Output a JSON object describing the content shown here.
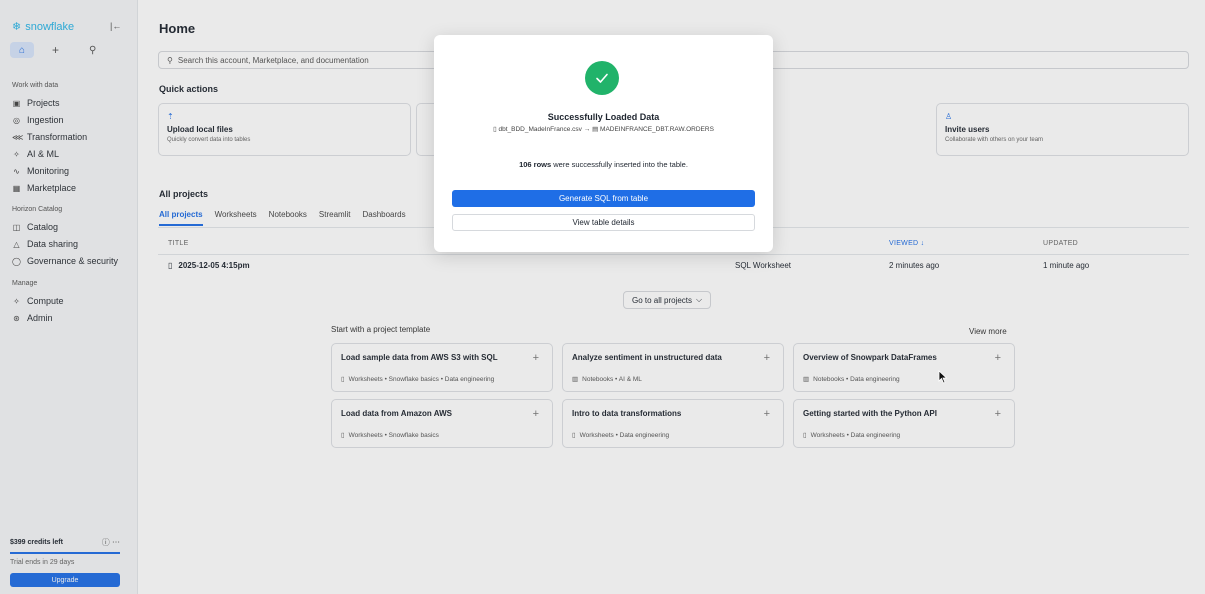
{
  "sidebar": {
    "logo": "snowflake",
    "sections": {
      "work": "Work with data",
      "horizon": "Horizon Catalog",
      "manage": "Manage"
    },
    "items": [
      {
        "label": "Projects",
        "icon": "projects-icon"
      },
      {
        "label": "Ingestion",
        "icon": "ingestion-icon"
      },
      {
        "label": "Transformation",
        "icon": "transformation-icon"
      },
      {
        "label": "AI & ML",
        "icon": "ai-ml-icon"
      },
      {
        "label": "Monitoring",
        "icon": "monitoring-icon"
      },
      {
        "label": "Marketplace",
        "icon": "marketplace-icon"
      },
      {
        "label": "Catalog",
        "icon": "catalog-icon"
      },
      {
        "label": "Data sharing",
        "icon": "data-sharing-icon"
      },
      {
        "label": "Governance & security",
        "icon": "shield-icon"
      },
      {
        "label": "Compute",
        "icon": "compute-icon"
      },
      {
        "label": "Admin",
        "icon": "admin-icon"
      }
    ],
    "credits": "$399 credits left",
    "credits_fraction": 1.0,
    "trial": "Trial ends in 29 days",
    "upgrade": "Upgrade"
  },
  "main": {
    "title": "Home",
    "search_placeholder": "Search this account, Marketplace, and documentation",
    "quick_actions_title": "Quick actions",
    "quick_actions": [
      {
        "title": "Upload local files",
        "desc": "Quickly convert data into tables"
      },
      {
        "title": "Invite users",
        "desc": "Collaborate with others on your team"
      }
    ],
    "all_projects_title": "All projects",
    "tabs": [
      "All projects",
      "Worksheets",
      "Notebooks",
      "Streamlit",
      "Dashboards"
    ],
    "columns": {
      "title": "TITLE",
      "viewed": "VIEWED ↓",
      "updated": "UPDATED"
    },
    "rows": [
      {
        "title": "2025-12-05 4:15pm",
        "type": "SQL Worksheet",
        "viewed": "2 minutes ago",
        "updated": "1 minute ago"
      }
    ],
    "go_all": "Go to all projects",
    "template_heading": "Start with a project template",
    "view_more": "View more",
    "templates": [
      {
        "title": "Load sample data from AWS S3 with SQL",
        "meta": "Worksheets • Snowflake basics • Data engineering"
      },
      {
        "title": "Analyze sentiment in unstructured data",
        "meta": "Notebooks • AI & ML"
      },
      {
        "title": "Overview of Snowpark DataFrames",
        "meta": "Notebooks • Data engineering"
      },
      {
        "title": "Load data from Amazon AWS",
        "meta": "Worksheets • Snowflake basics"
      },
      {
        "title": "Intro to data transformations",
        "meta": "Worksheets • Data engineering"
      },
      {
        "title": "Getting started with the Python API",
        "meta": "Worksheets • Data engineering"
      }
    ]
  },
  "modal": {
    "title": "Successfully Loaded Data",
    "source_file": "dbt_BDD_MadeInFrance.csv",
    "arrow": "→",
    "target_table": "MADEINFRANCE_DBT.RAW.ORDERS",
    "rows_count": "106 rows",
    "rows_text": "were successfully inserted into the table.",
    "primary_button": "Generate SQL from table",
    "secondary_button": "View table details"
  },
  "colors": {
    "accent": "#1f6ee6",
    "success": "#21b36a",
    "brand": "#29b5e8"
  }
}
